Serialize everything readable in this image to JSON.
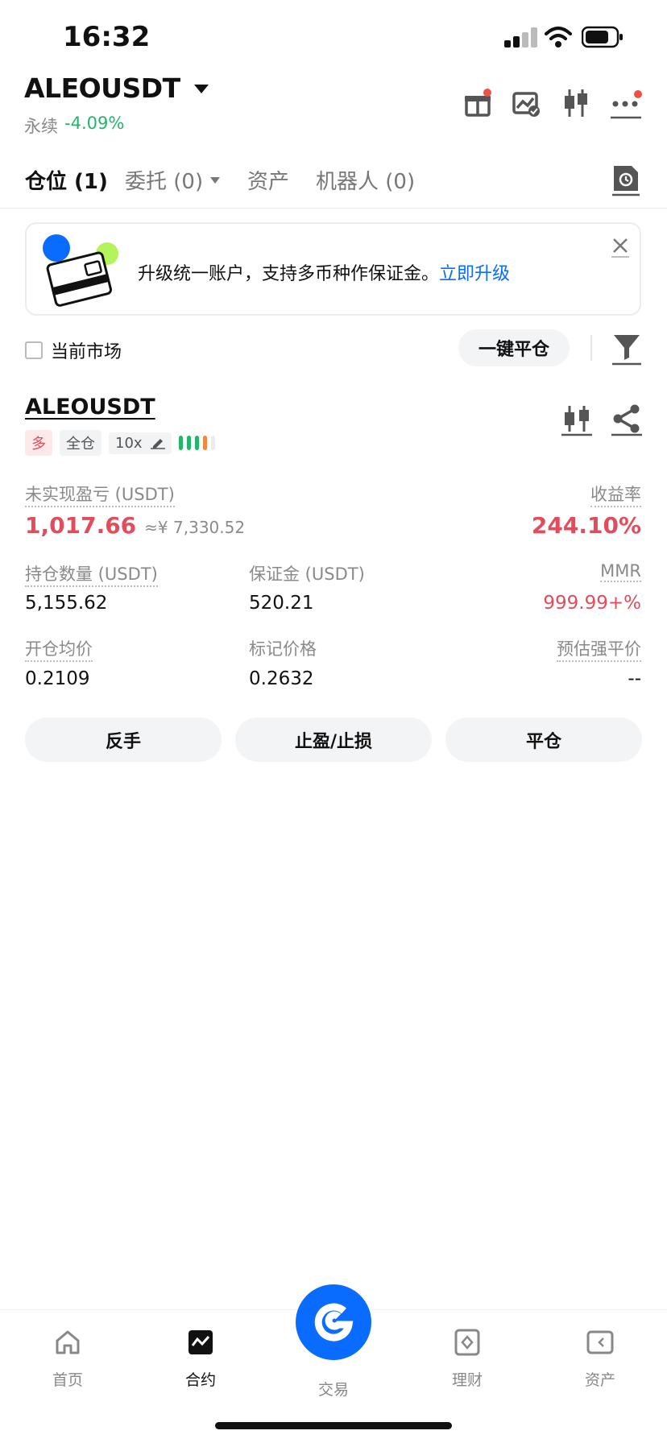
{
  "status_bar": {
    "time": "16:32"
  },
  "header": {
    "symbol": "ALEOUSDT",
    "type": "永续",
    "change": "-4.09%"
  },
  "tabs": [
    {
      "label": "仓位 (1)"
    },
    {
      "label": "委托 (0)"
    },
    {
      "label": "资产"
    },
    {
      "label": "机器人 (0)"
    }
  ],
  "banner": {
    "text": "升级统一账户，支持多币种作保证金。",
    "link": "立即升级"
  },
  "filter": {
    "current_market_label": "当前市场",
    "close_all_label": "一键平仓"
  },
  "position": {
    "symbol": "ALEOUSDT",
    "side": "多",
    "margin_mode": "全仓",
    "leverage": "10x",
    "pnl_label": "未实现盈亏 (USDT)",
    "pnl_value": "1,017.66",
    "pnl_cny": "≈¥ 7,330.52",
    "roe_label": "收益率",
    "roe_value": "244.10%",
    "size_label": "持仓数量 (USDT)",
    "size_value": "5,155.62",
    "margin_label": "保证金 (USDT)",
    "margin_value": "520.21",
    "mmr_label": "MMR",
    "mmr_value": "999.99+%",
    "entry_label": "开仓均价",
    "entry_value": "0.2109",
    "mark_label": "标记价格",
    "mark_value": "0.2632",
    "liq_label": "预估强平价",
    "liq_value": "--",
    "actions": {
      "reverse": "反手",
      "tpsl": "止盈/止损",
      "close": "平仓"
    }
  },
  "bottom_nav": [
    {
      "label": "首页"
    },
    {
      "label": "合约"
    },
    {
      "label": "交易"
    },
    {
      "label": "理财"
    },
    {
      "label": "资产"
    }
  ],
  "colors": {
    "accent": "#0a6cff",
    "up": "#22b66b",
    "down": "#e34d5b"
  }
}
